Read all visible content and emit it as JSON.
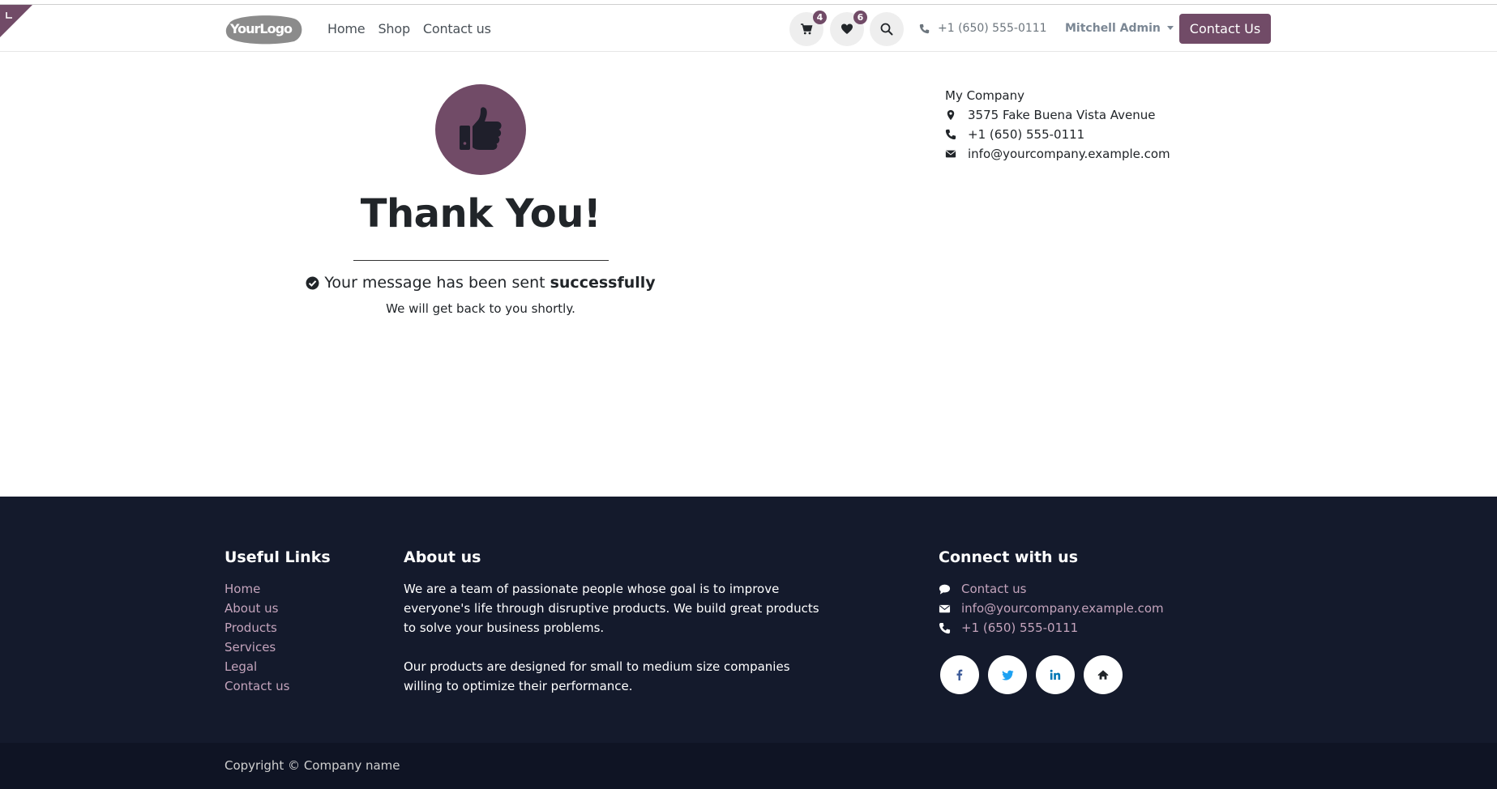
{
  "header": {
    "logo_text": "YourLogo",
    "nav": [
      "Home",
      "Shop",
      "Contact us"
    ],
    "cart_count": "4",
    "wishlist_count": "6",
    "phone": "+1 (650) 555-0111",
    "user": "Mitchell Admin",
    "cta": "Contact Us"
  },
  "main": {
    "title": "Thank You!",
    "success_prefix": "Your message has been sent",
    "success_bold": "successfully",
    "subtext": "We will get back to you shortly."
  },
  "company": {
    "name": "My Company",
    "address": "3575 Fake Buena Vista Avenue",
    "phone": "+1 (650) 555-0111",
    "email": "info@yourcompany.example.com"
  },
  "footer": {
    "useful_links_title": "Useful Links",
    "useful_links": [
      "Home",
      "About us",
      "Products",
      "Services",
      "Legal",
      "Contact us"
    ],
    "about_title": "About us",
    "about_p1": "We are a team of passionate people whose goal is to improve everyone's life through disruptive products. We build great products to solve your business problems.",
    "about_p2": "Our products are designed for small to medium size companies willing to optimize their performance.",
    "connect_title": "Connect with us",
    "connect_contact": "Contact us",
    "connect_email": "info@yourcompany.example.com",
    "connect_phone": "+1 (650) 555-0111",
    "socials": [
      "facebook-icon",
      "twitter-icon",
      "linkedin-icon",
      "home-icon"
    ],
    "copyright": "Copyright © Company name"
  },
  "colors": {
    "brand": "#714b67",
    "footer_bg": "#141a2c",
    "footer_link": "#c4a4bc"
  }
}
